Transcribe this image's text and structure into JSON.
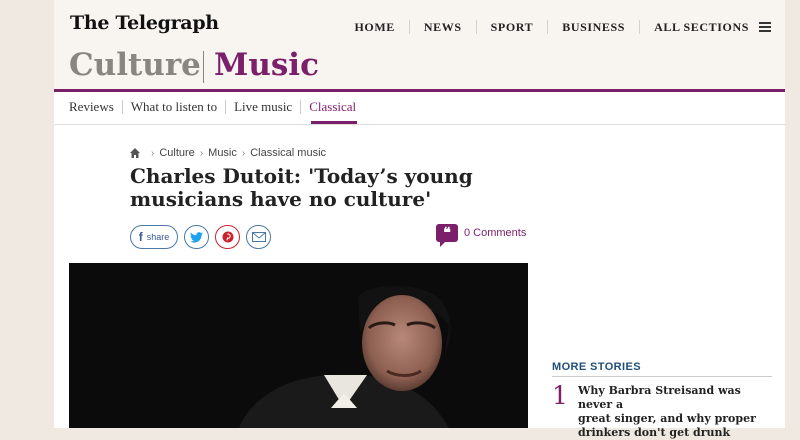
{
  "masthead": {
    "logo": "The Telegraph"
  },
  "main_nav": {
    "items": [
      "HOME",
      "NEWS",
      "SPORT",
      "BUSINESS",
      "ALL SECTIONS"
    ]
  },
  "section": {
    "parent": "Culture",
    "current": "Music"
  },
  "sub_nav": {
    "items": [
      "Reviews",
      "What to listen to",
      "Live music",
      "Classical"
    ],
    "active": "Classical"
  },
  "breadcrumbs": [
    "Culture",
    "Music",
    "Classical music"
  ],
  "article": {
    "headline_line1": "Charles Dutoit: 'Today’s young",
    "headline_line2": "musicians have no culture'",
    "share_label": "share",
    "comments": "0 Comments"
  },
  "sidebar": {
    "heading": "MORE STORIES",
    "story": {
      "number": "1",
      "line1": "Why Barbra Streisand was never a",
      "line2": "great singer, and why proper",
      "line3": "drinkers don't get drunk"
    }
  },
  "colors": {
    "accent": "#7b1f6a",
    "link_blue": "#1f4f7a",
    "section_grey": "#8a8581"
  },
  "icons": [
    "hamburger-icon",
    "home-icon",
    "facebook-icon",
    "twitter-icon",
    "pinterest-icon",
    "email-icon",
    "comment-bubble-icon"
  ]
}
